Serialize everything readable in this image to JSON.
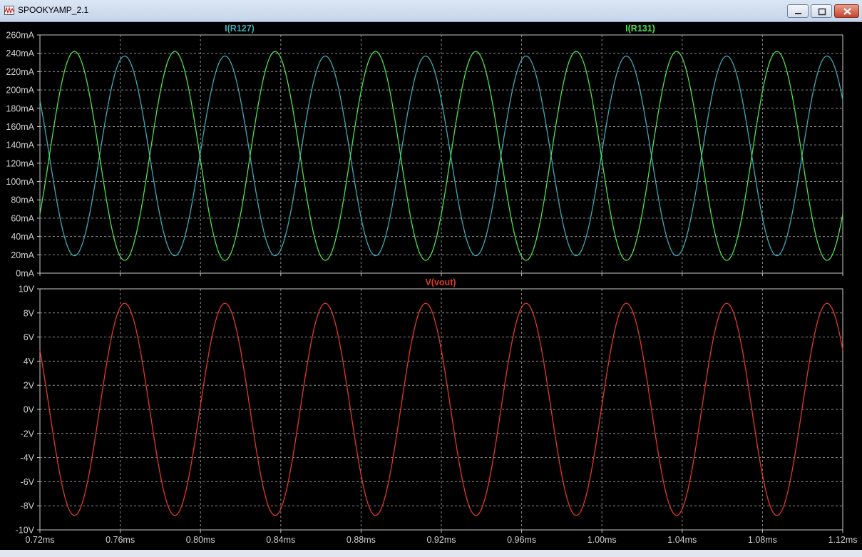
{
  "window": {
    "title": "SPOOKYAMP_2.1",
    "icons": [
      "waveform-app-icon",
      "minimize-icon",
      "maximize-icon",
      "close-icon"
    ]
  },
  "colors": {
    "background": "#000000",
    "grid": "#8c8c8c",
    "frame": "#c8c8c8",
    "axis_text": "#d0d0d0",
    "series_R127": "#3fa8b5",
    "series_R131": "#4fe04f",
    "series_vout": "#e03a2a"
  },
  "chart_data": [
    {
      "type": "line",
      "title": "",
      "xlabel": "",
      "ylabel": "",
      "xlim": [
        0.72,
        1.12
      ],
      "ylim": [
        0,
        260
      ],
      "x_unit": "ms",
      "y_unit": "mA",
      "grid": true,
      "legend": "top labels",
      "yticks": [
        "0mA",
        "20mA",
        "40mA",
        "60mA",
        "80mA",
        "100mA",
        "120mA",
        "140mA",
        "160mA",
        "180mA",
        "200mA",
        "220mA",
        "240mA",
        "260mA"
      ],
      "series": [
        {
          "name": "I(R127)",
          "color": "#3fa8b5",
          "label_position": "top-left",
          "shape": "sine",
          "period_ms": 0.05,
          "min": 19,
          "max": 237,
          "peaks_x": [
            0.7622,
            0.8122,
            0.8622,
            0.9122,
            0.9622,
            1.0122,
            1.0622,
            1.1122
          ],
          "value_at_start": 160,
          "value_at_end": 163
        },
        {
          "name": "I(R131)",
          "color": "#4fe04f",
          "label_position": "top-right",
          "shape": "sine",
          "period_ms": 0.05,
          "min": 14,
          "max": 242,
          "peaks_x": [
            0.7372,
            0.7872,
            0.8372,
            0.8872,
            0.9372,
            0.9872,
            1.0372,
            1.0872
          ],
          "value_at_start": 39,
          "value_at_end": 36
        }
      ]
    },
    {
      "type": "line",
      "title": "",
      "xlabel": "",
      "ylabel": "",
      "xlim": [
        0.72,
        1.12
      ],
      "ylim": [
        -10,
        10
      ],
      "x_unit": "ms",
      "y_unit": "V",
      "grid": true,
      "legend": "top-center",
      "xticks": [
        "0.72ms",
        "0.76ms",
        "0.80ms",
        "0.84ms",
        "0.88ms",
        "0.92ms",
        "0.96ms",
        "1.00ms",
        "1.04ms",
        "1.08ms",
        "1.12ms"
      ],
      "yticks": [
        "-10V",
        "-8V",
        "-6V",
        "-4V",
        "-2V",
        "0V",
        "2V",
        "4V",
        "6V",
        "8V",
        "10V"
      ],
      "series": [
        {
          "name": "V(vout)",
          "color": "#e03a2a",
          "shape": "sine",
          "period_ms": 0.05,
          "min": -8.8,
          "max": 8.8,
          "peaks_x": [
            0.7622,
            0.8122,
            0.8622,
            0.9122,
            0.9622,
            1.0122,
            1.0622,
            1.1122
          ],
          "value_at_start": 5.3,
          "value_at_end": 5.5
        }
      ]
    }
  ]
}
